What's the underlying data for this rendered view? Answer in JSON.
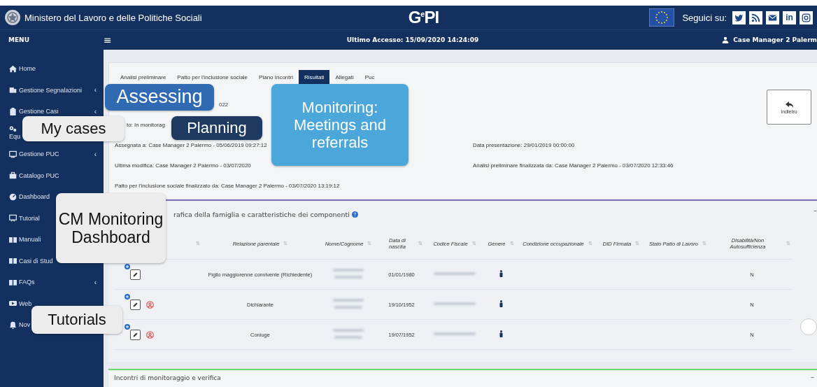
{
  "header": {
    "ministry": "Ministero del Lavoro e delle Politiche Sociali",
    "logo": "G$^{e}$PI",
    "follow_label": "Seguici su:",
    "social": [
      {
        "kind": "twitter"
      },
      {
        "kind": "rss"
      },
      {
        "kind": "mail"
      },
      {
        "kind": "linkedin",
        "text": "in"
      },
      {
        "kind": "instagram"
      }
    ]
  },
  "subbar": {
    "menu_label": "MENU",
    "hamburger": "≡",
    "last_access": "Ultimo Accesso: 15/09/2020 14:24:09",
    "user": "Case Manager 2 Palerm"
  },
  "sidebar": {
    "items": [
      {
        "label": "Home",
        "kind": "home"
      },
      {
        "label": "Gestione Segnalazioni",
        "kind": "report",
        "chevron": "‹"
      },
      {
        "label": "Gestione Casi",
        "kind": "clipboard",
        "chevron": "‹"
      },
      {
        "label": "Equ",
        "kind": "gears"
      },
      {
        "label": "Gestione PUC",
        "kind": "monitor",
        "chevron": "‹"
      },
      {
        "label": "Catalogo PUC",
        "kind": "briefcase"
      },
      {
        "label": "Dashboard",
        "kind": "gauge"
      },
      {
        "label": "Tutorial",
        "kind": "screen"
      },
      {
        "label": "Manuali",
        "kind": "book"
      },
      {
        "label": "Casi di Stud",
        "kind": "book"
      },
      {
        "label": "FAQs",
        "kind": "book",
        "chevron": "‹"
      },
      {
        "label": "Web",
        "kind": "video"
      },
      {
        "label": "Nov",
        "kind": "bell"
      }
    ]
  },
  "tabs": [
    {
      "label": "Analisi preliminare",
      "selected": false
    },
    {
      "label": "Patto per l'inclusione sociale",
      "selected": false
    },
    {
      "label": "Piano Incontri",
      "selected": false
    },
    {
      "label": "Risultati",
      "selected": true
    },
    {
      "label": "Allegati",
      "selected": false
    },
    {
      "label": "Puc",
      "selected": false
    }
  ],
  "back_button": "Indietro",
  "info": {
    "code_tail": "022",
    "status": "to: In monitorag",
    "assigned": "Assegnata a: Case Manager 2 Palermo - 05/06/2019 09:27:12",
    "modified": "Ultima modifica: Case Manager 2 Palermo - 03/07/2020",
    "submitted": "Data presentazione: 29/01/2019 00:00:00",
    "analysis_done": "Analisi preliminare finalizzata da: Case Manager 2 Palermo - 03/07/2020 12:33:46",
    "pact_done": "Patto per l'inclusione sociale finalizzato da: Case Manager 2 Palermo - 03/07/2020 13:19:12"
  },
  "section_1": {
    "title": "rafica della famiglia e caratteristiche dei componenti",
    "collapse": "–",
    "table": {
      "columns": [
        {
          "sort": "⇅"
        },
        {
          "label": "Relazione parentale",
          "sort": "⇅"
        },
        {
          "label": "Nome/Cognome",
          "sort": "⇅"
        },
        {
          "label": "Data di nascita",
          "sort": "⇅"
        },
        {
          "label": "Codice Fiscale",
          "sort": "⇅"
        },
        {
          "label": "Genere",
          "sort": "⇅"
        },
        {
          "label": "Condizione occupazionale",
          "sort": "⇅"
        },
        {
          "label": "DID Firmata",
          "sort": "⇅"
        },
        {
          "label": "Stato Patto di Lavoro",
          "sort": "⇅"
        },
        {
          "label": "Disabilità/Non Autosufficienza",
          "sort": "⇅"
        }
      ],
      "rows": [
        {
          "relation": "Figlio maggiorenne convivente (Richiedente)",
          "birth": "01/01/1980",
          "disability": "N",
          "flagged": false
        },
        {
          "relation": "Dichiarante",
          "birth": "19/10/1952",
          "disability": "N",
          "flagged": true
        },
        {
          "relation": "Coniuge",
          "birth": "19/07/1952",
          "disability": "N",
          "flagged": true
        }
      ]
    }
  },
  "section_2": {
    "title": "Incontri di monitoraggio e verifica",
    "collapse": "–"
  },
  "callouts": [
    {
      "text": "Assessing",
      "kind": "blue"
    },
    {
      "text": "My cases",
      "kind": "grey"
    },
    {
      "text": "Planning",
      "kind": "navy"
    },
    {
      "text": "Monitoring: Meetings and referrals",
      "kind": "sky"
    },
    {
      "text": "CM Monitoring Dashboard",
      "kind": "grey"
    },
    {
      "text": "Tutorials",
      "kind": "grey"
    }
  ]
}
